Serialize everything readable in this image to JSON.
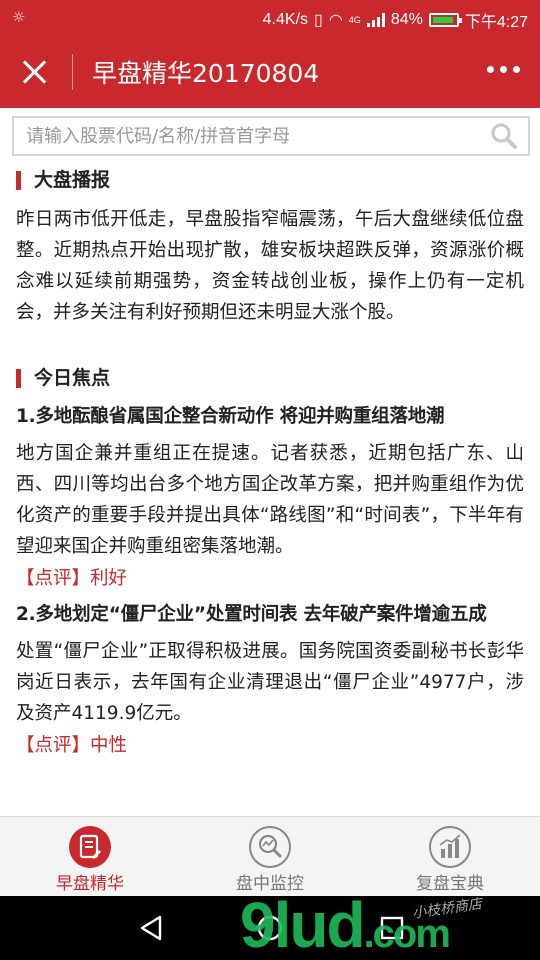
{
  "status_bar": {
    "network_speed": "4.4K/s",
    "network_type": "4G",
    "battery": "84%",
    "time": "下午4:27"
  },
  "header": {
    "title": "早盘精华20170804"
  },
  "search": {
    "placeholder": "请输入股票代码/名称/拼音首字母"
  },
  "sections": {
    "market_report": {
      "heading": "大盘播报",
      "body": "昨日两市低开低走，早盘股指窄幅震荡，午后大盘继续低位盘整。近期热点开始出现扩散，雄安板块超跌反弹，资源涨价概念难以延续前期强势，资金转战创业板，操作上仍有一定机会，并多关注有利好预期但还未明显大涨个股。"
    },
    "focus": {
      "heading": "今日焦点",
      "items": [
        {
          "title": "1.多地酝酿省属国企整合新动作 将迎并购重组落地潮",
          "body": "地方国企兼并重组正在提速。记者获悉，近期包括广东、山西、四川等均出台多个地方国企改革方案，把并购重组作为优化资产的重要手段并提出具体“路线图”和“时间表”，下半年有望迎来国企并购重组密集落地潮。",
          "comment": "【点评】利好"
        },
        {
          "title": "2.多地划定“僵尸企业”处置时间表 去年破产案件增逾五成",
          "body": "处置“僵尸企业”正取得积极进展。国务院国资委副秘书长彭华岗近日表示，去年国有企业清理退出“僵尸企业”4977户，涉及资产4119.9亿元。",
          "comment": "【点评】中性"
        }
      ]
    }
  },
  "tabbar": {
    "tabs": [
      {
        "label": "早盘精华",
        "icon": "document-icon",
        "active": true
      },
      {
        "label": "盘中监控",
        "icon": "magnifier-chart-icon",
        "active": false
      },
      {
        "label": "复盘宝典",
        "icon": "bar-chart-icon",
        "active": false
      }
    ]
  },
  "watermark": {
    "logo": "9lud",
    "domain": ".com",
    "sub": "小枝桥商店"
  },
  "colors": {
    "brand_red": "#c9282d",
    "inactive_gray": "#777777"
  }
}
